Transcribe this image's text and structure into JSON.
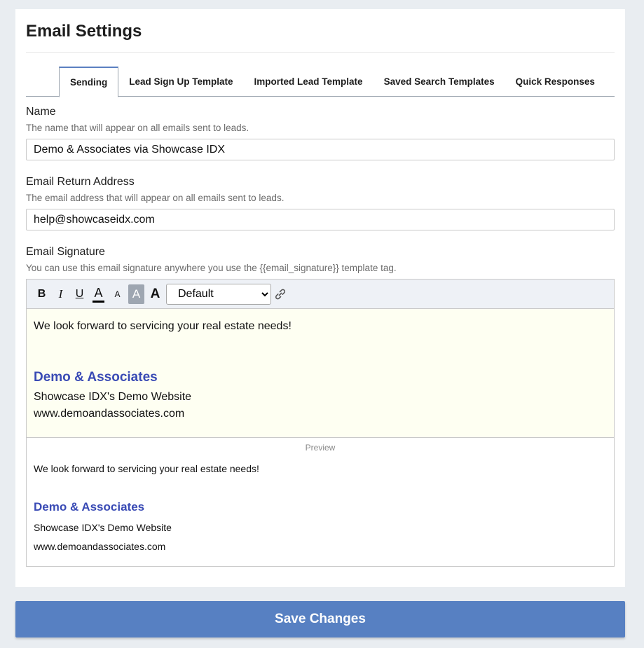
{
  "page": {
    "title": "Email Settings"
  },
  "tabs": [
    {
      "label": "Sending",
      "active": true
    },
    {
      "label": "Lead Sign Up Template"
    },
    {
      "label": "Imported Lead Template"
    },
    {
      "label": "Saved Search Templates"
    },
    {
      "label": "Quick Responses"
    }
  ],
  "name_field": {
    "label": "Name",
    "help": "The name that will appear on all emails sent to leads.",
    "value": "Demo & Associates via Showcase IDX"
  },
  "return_field": {
    "label": "Email Return Address",
    "help": "The email address that will appear on all emails sent to leads.",
    "value": "help@showcaseidx.com"
  },
  "signature": {
    "label": "Email Signature",
    "help": "You can use this email signature anywhere you use the {{email_signature}} template tag.",
    "toolbar": {
      "bold": "B",
      "italic": "I",
      "underline": "U",
      "color": "A",
      "small": "A",
      "bgcolor": "A",
      "large": "A",
      "font_selected": "Default",
      "link_icon": "link-icon"
    },
    "body": {
      "line1": "We look forward to servicing your real estate needs!",
      "company": "Demo & Associates",
      "tagline": "Showcase IDX's Demo Website",
      "website": "www.demoandassociates.com"
    },
    "preview_label": "Preview"
  },
  "save_label": "Save Changes",
  "colors": {
    "accent": "#5780c2",
    "company": "#3a4bb5",
    "editor_bg": "#fefff2"
  }
}
